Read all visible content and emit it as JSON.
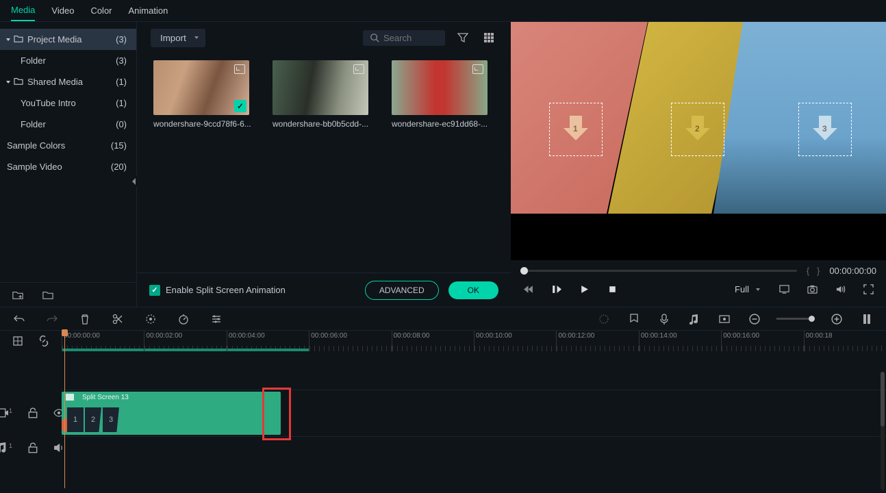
{
  "tabs": [
    "Media",
    "Video",
    "Color",
    "Animation"
  ],
  "sidebar": {
    "items": [
      {
        "label": "Project Media",
        "count": "(3)",
        "level": 0,
        "expandable": true
      },
      {
        "label": "Folder",
        "count": "(3)",
        "level": 1,
        "expandable": false
      },
      {
        "label": "Shared Media",
        "count": "(1)",
        "level": 0,
        "expandable": true
      },
      {
        "label": "YouTube Intro",
        "count": "(1)",
        "level": 1,
        "expandable": false
      },
      {
        "label": "Folder",
        "count": "(0)",
        "level": 1,
        "expandable": false
      },
      {
        "label": "Sample Colors",
        "count": "(15)",
        "level": -1,
        "expandable": false
      },
      {
        "label": "Sample Video",
        "count": "(20)",
        "level": -1,
        "expandable": false
      }
    ]
  },
  "media": {
    "import_label": "Import",
    "search_placeholder": "Search",
    "thumbs": [
      {
        "name": "wondershare-9ccd78f6-6...",
        "checked": true
      },
      {
        "name": "wondershare-bb0b5cdd-...",
        "checked": false
      },
      {
        "name": "wondershare-ec91dd68-...",
        "checked": false
      }
    ]
  },
  "split_screen": {
    "enable_label": "Enable Split Screen Animation",
    "advanced": "ADVANCED",
    "ok": "OK"
  },
  "preview": {
    "zones": [
      "1",
      "2",
      "3"
    ],
    "timecode": "00:00:00:00",
    "mode": "Full"
  },
  "timeline": {
    "ruler": [
      "00:00:00:00",
      "00:00:02:00",
      "00:00:04:00",
      "00:00:06:00",
      "00:00:08:00",
      "00:00:10:00",
      "00:00:12:00",
      "00:00:14:00",
      "00:00:16:00",
      "00:00:18"
    ],
    "clip_name": "Split Screen 13",
    "clip_segs": [
      "1",
      "2",
      "3"
    ]
  }
}
